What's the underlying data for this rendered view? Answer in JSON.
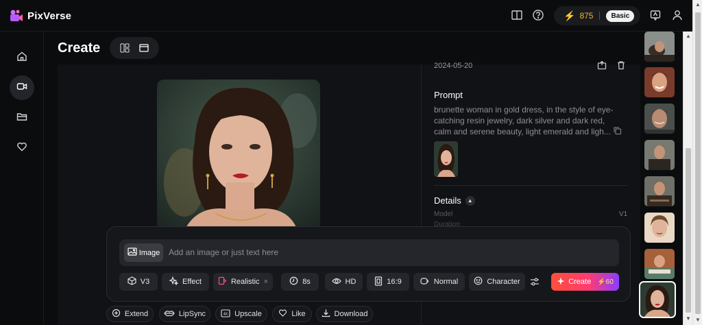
{
  "app": {
    "name": "PixVerse",
    "credits": "875",
    "plan": "Basic"
  },
  "header": {
    "title": "Create"
  },
  "detail": {
    "date": "2024-05-20",
    "prompt_label": "Prompt",
    "prompt_text": "brunette woman in gold dress, in the style of eye-catching resin jewelry, dark silver and dark red, calm and serene beauty, light emerald and ligh...",
    "details_label": "Details",
    "model_label": "Model",
    "model_value": "V1",
    "duration_label": "Duration"
  },
  "composer": {
    "image_chip": "Image",
    "placeholder": "Add an image or just text here",
    "options": {
      "model": "V3",
      "effect": "Effect",
      "style": "Realistic",
      "duration": "8s",
      "quality": "HD",
      "ratio": "16:9",
      "motion": "Normal",
      "character": "Character"
    },
    "create_label": "Create",
    "create_cost": "60"
  },
  "actions": {
    "extend": "Extend",
    "lipsync": "LipSync",
    "upscale": "Upscale",
    "like": "Like",
    "download": "Download"
  },
  "colors": {
    "accent_gold": "#f5b82a",
    "create_gradient_start": "#ff4f3a",
    "create_gradient_end": "#8a3dff"
  },
  "icons": {
    "nav": [
      "home-icon",
      "video-icon",
      "folder-icon",
      "heart-icon"
    ],
    "top": [
      "book-icon",
      "help-icon",
      "bolt-icon",
      "feedback-icon",
      "user-icon"
    ]
  }
}
